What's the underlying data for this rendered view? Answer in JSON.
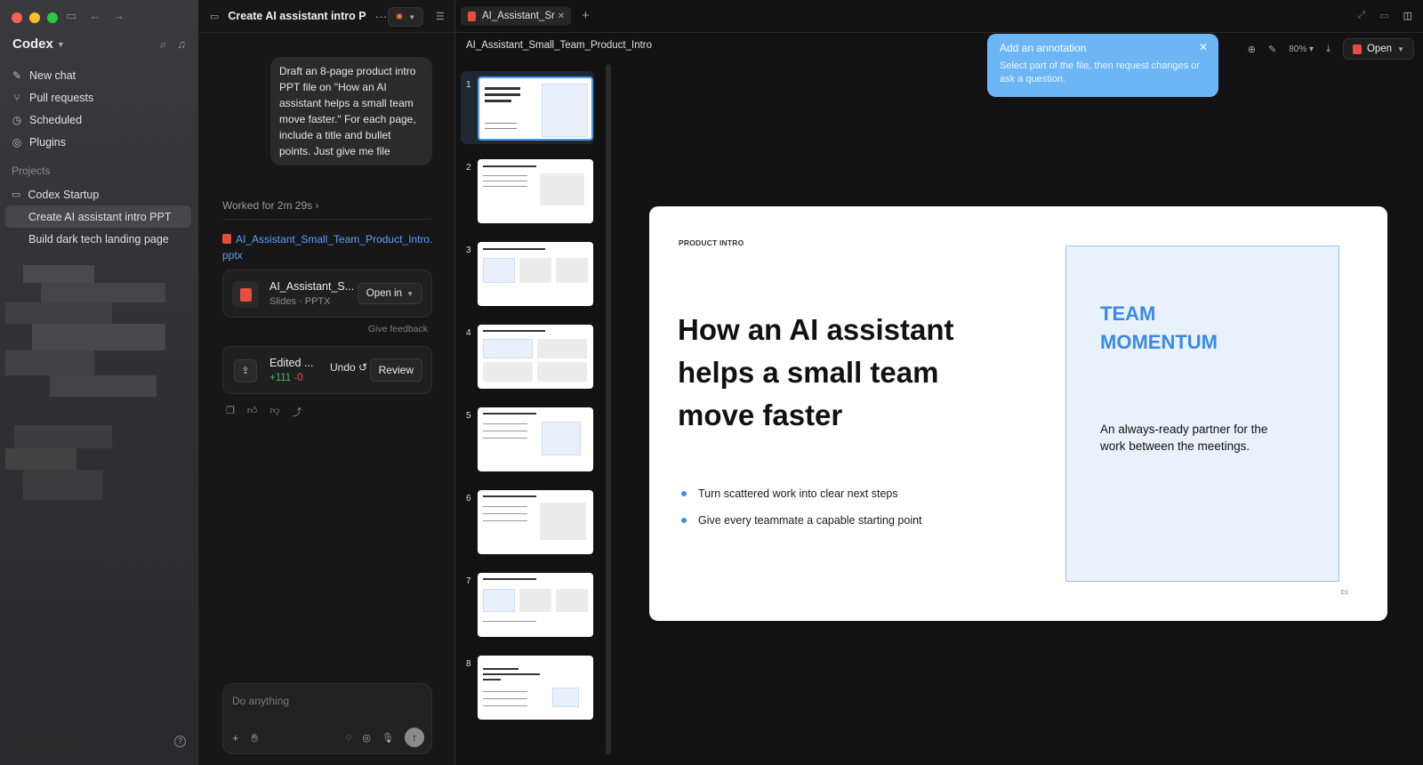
{
  "sidebar": {
    "brand": "Codex",
    "nav": [
      {
        "label": "New chat",
        "icon": "compose-icon"
      },
      {
        "label": "Pull requests",
        "icon": "pull-request-icon"
      },
      {
        "label": "Scheduled",
        "icon": "clock-icon"
      },
      {
        "label": "Plugins",
        "icon": "plugin-icon"
      }
    ],
    "projects_label": "Projects",
    "project": "Codex Startup",
    "project_items": [
      "Create AI assistant intro PPT",
      "Build dark tech landing page"
    ]
  },
  "chat": {
    "title": "Create AI assistant intro P",
    "user_message": "Draft an 8-page product intro PPT file on \"How an AI assistant helps a small team move faster.\" For each page, include a title and bullet points. Just give me file",
    "worked": "Worked for 2m 29s",
    "file_link": "AI_Assistant_Small_Team_Product_Intro.pptx",
    "file_card": {
      "name": "AI_Assistant_S...",
      "meta": "Slides · PPTX",
      "open_label": "Open in"
    },
    "give_feedback": "Give feedback",
    "edit_card": {
      "name": "Edited ...",
      "added": "+111",
      "removed": "-0",
      "undo": "Undo",
      "review": "Review"
    },
    "composer_placeholder": "Do anything"
  },
  "viewer": {
    "tab_label": "AI_Assistant_Sr",
    "doc_title": "AI_Assistant_Small_Team_Product_Intro",
    "zoom": "80%",
    "open_label": "Open",
    "tooltip": {
      "title": "Add an annotation",
      "body": "Select part of the file, then request changes or ask a question."
    },
    "thumb_numbers": [
      "1",
      "2",
      "3",
      "4",
      "5",
      "6",
      "7",
      "8"
    ],
    "slide": {
      "eyebrow": "PRODUCT INTRO",
      "headline": "How an AI assistant helps a small team move faster",
      "bullets": [
        "Turn scattered work into clear next steps",
        "Give every teammate a capable starting point"
      ],
      "panel_title": "TEAM MOMENTUM",
      "panel_text": "An always-ready partner for the work between the meetings.",
      "page_number": "01"
    }
  },
  "colors": {
    "accent_blue": "#3a8ae8",
    "tooltip_blue": "#6db6f5",
    "pdf_red": "#e84c3d",
    "diff_add": "#3fbf5f",
    "diff_del": "#e85050"
  }
}
